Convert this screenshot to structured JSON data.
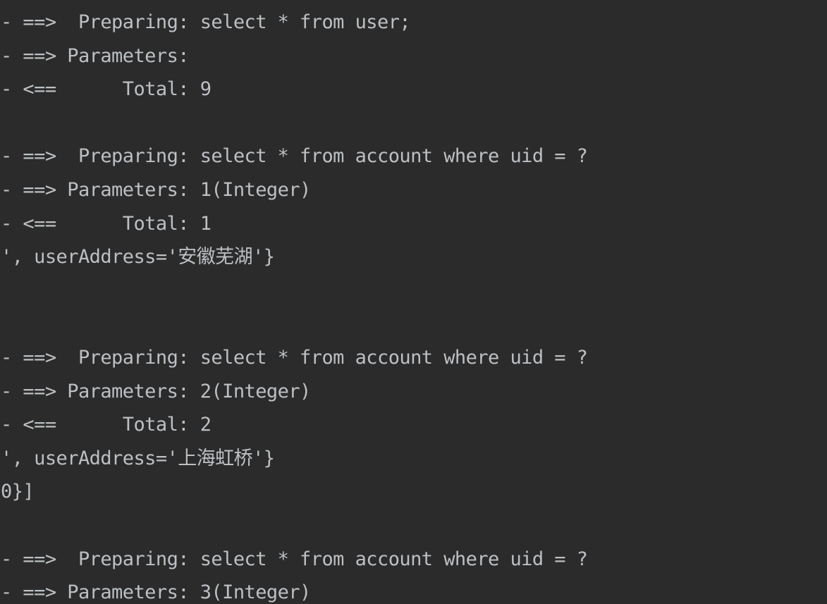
{
  "console": {
    "app_kind": "terminal-console-log",
    "background_color": "#2b2b2b",
    "text_color": "#bcc0c4",
    "font_size_px": 27,
    "line_height_px": 47.6,
    "lines": [
      {
        "id": 0,
        "text": "- ==>  Preparing: select * from user;"
      },
      {
        "id": 1,
        "text": "- ==> Parameters: "
      },
      {
        "id": 2,
        "text": "- <==      Total: 9"
      },
      {
        "id": 3,
        "text": ""
      },
      {
        "id": 4,
        "text": "- ==>  Preparing: select * from account where uid = ?"
      },
      {
        "id": 5,
        "text": "- ==> Parameters: 1(Integer)"
      },
      {
        "id": 6,
        "text": "- <==      Total: 1"
      },
      {
        "id": 7,
        "text": "', userAddress='安徽芜湖'}"
      },
      {
        "id": 8,
        "text": ""
      },
      {
        "id": 9,
        "text": ""
      },
      {
        "id": 10,
        "text": "- ==>  Preparing: select * from account where uid = ?"
      },
      {
        "id": 11,
        "text": "- ==> Parameters: 2(Integer)"
      },
      {
        "id": 12,
        "text": "- <==      Total: 2"
      },
      {
        "id": 13,
        "text": "', userAddress='上海虹桥'}"
      },
      {
        "id": 14,
        "text": "0}]"
      },
      {
        "id": 15,
        "text": ""
      },
      {
        "id": 16,
        "text": "- ==>  Preparing: select * from account where uid = ?"
      },
      {
        "id": 17,
        "text": "- ==> Parameters: 3(Integer)"
      }
    ]
  }
}
